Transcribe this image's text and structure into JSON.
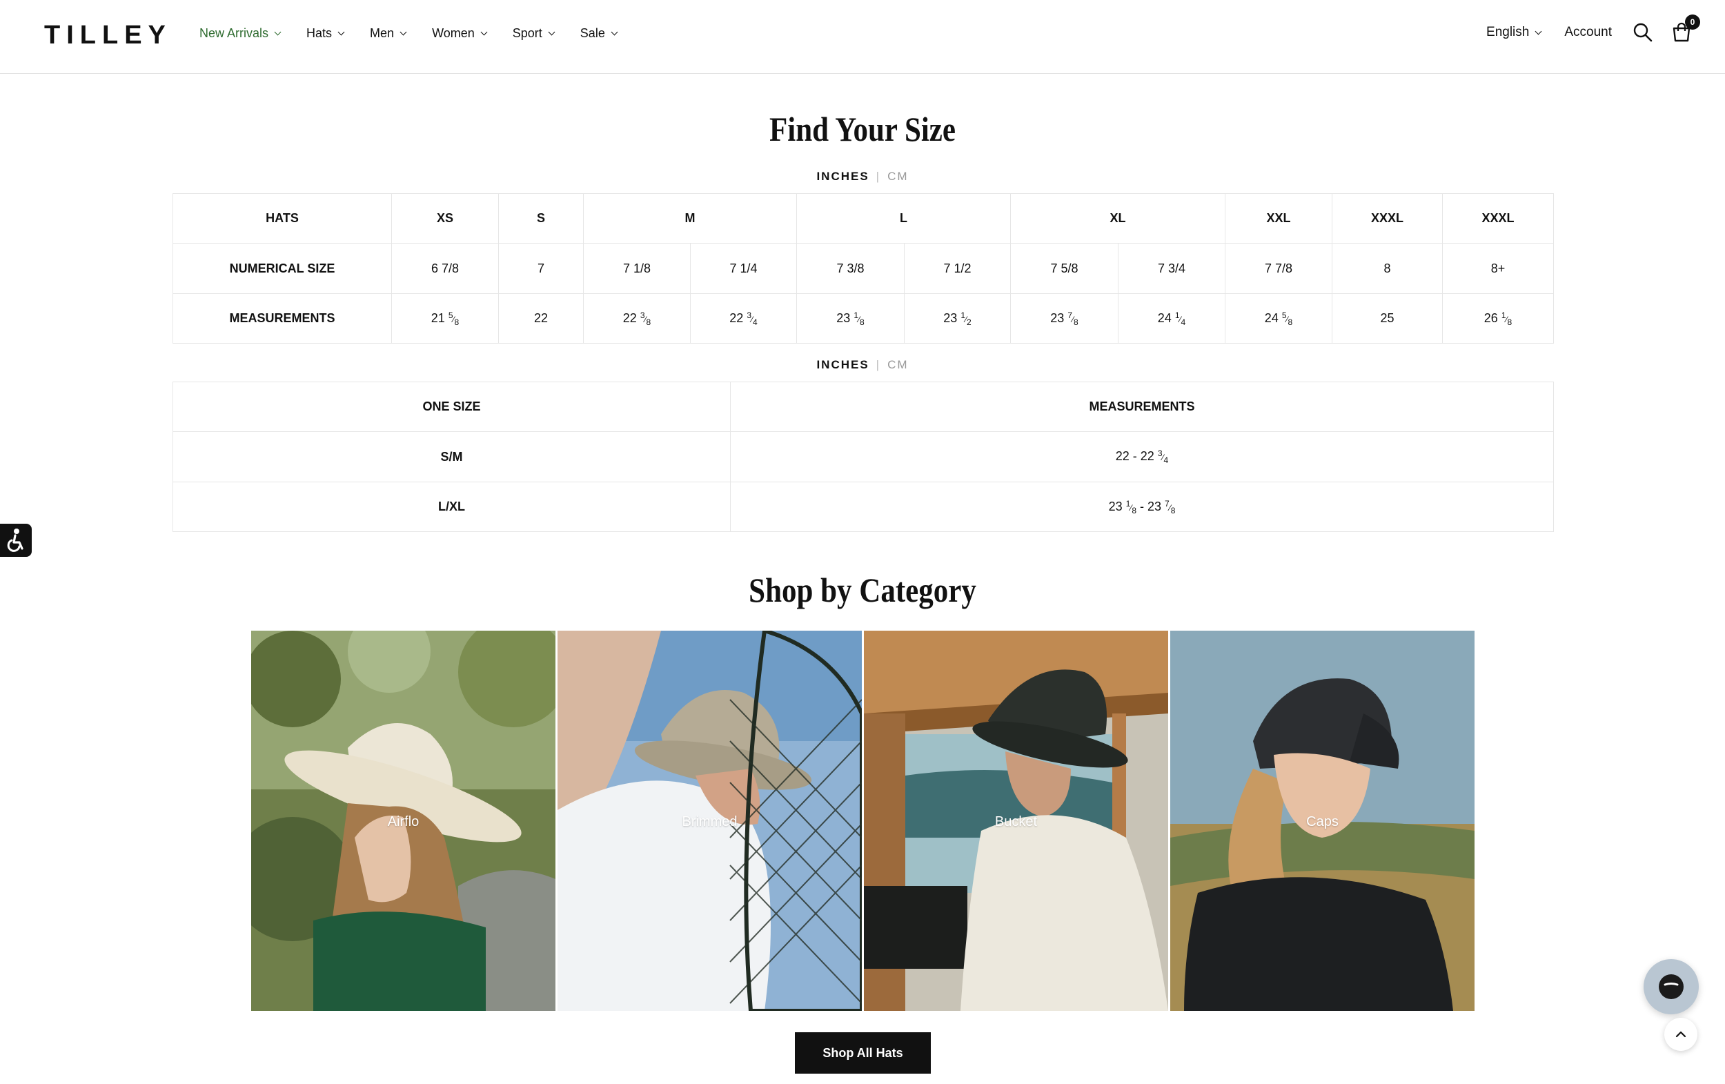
{
  "brand": {
    "logo": "TILLEY",
    "accent": "#2e6b2f"
  },
  "nav": [
    {
      "label": "New Arrivals",
      "active": true
    },
    {
      "label": "Hats"
    },
    {
      "label": "Men"
    },
    {
      "label": "Women"
    },
    {
      "label": "Sport"
    },
    {
      "label": "Sale"
    }
  ],
  "header": {
    "language": "English",
    "account": "Account",
    "cart_count": "0"
  },
  "size_section": {
    "title": "Find Your Size",
    "units": {
      "active": "INCHES",
      "inactive": "CM"
    }
  },
  "hats_table": {
    "row_labels": [
      "HATS",
      "NUMERICAL SIZE",
      "MEASUREMENTS"
    ],
    "sizes": [
      "XS",
      "S",
      "M",
      "L",
      "XL",
      "XXL",
      "XXXL",
      "XXXL"
    ],
    "numerical": [
      "6 7/8",
      "7",
      "7 1/8",
      "7 1/4",
      "7 3/8",
      "7 1/2",
      "7 5/8",
      "7 3/4",
      "7 7/8",
      "8",
      "8+"
    ],
    "measurements": [
      {
        "whole": "21",
        "num": "5",
        "den": "8"
      },
      {
        "whole": "22",
        "num": "",
        "den": ""
      },
      {
        "whole": "22",
        "num": "3",
        "den": "8"
      },
      {
        "whole": "22",
        "num": "3",
        "den": "4"
      },
      {
        "whole": "23",
        "num": "1",
        "den": "8"
      },
      {
        "whole": "23",
        "num": "1",
        "den": "2"
      },
      {
        "whole": "23",
        "num": "7",
        "den": "8"
      },
      {
        "whole": "24",
        "num": "1",
        "den": "4"
      },
      {
        "whole": "24",
        "num": "5",
        "den": "8"
      },
      {
        "whole": "25",
        "num": "",
        "den": ""
      },
      {
        "whole": "26",
        "num": "1",
        "den": "8"
      }
    ]
  },
  "onesize_table": {
    "headers": [
      "ONE SIZE",
      "MEASUREMENTS"
    ],
    "rows": [
      {
        "size": "S/M",
        "from_whole": "22",
        "from_num": "",
        "from_den": "",
        "to_whole": "22",
        "to_num": "3",
        "to_den": "4"
      },
      {
        "size": "L/XL",
        "from_whole": "23",
        "from_num": "1",
        "from_den": "8",
        "to_whole": "23",
        "to_num": "7",
        "to_den": "8"
      }
    ]
  },
  "category_section": {
    "title": "Shop by Category",
    "tiles": [
      "Airflo",
      "Brimmed",
      "Bucket",
      "Caps"
    ],
    "cta": "Shop All Hats"
  }
}
